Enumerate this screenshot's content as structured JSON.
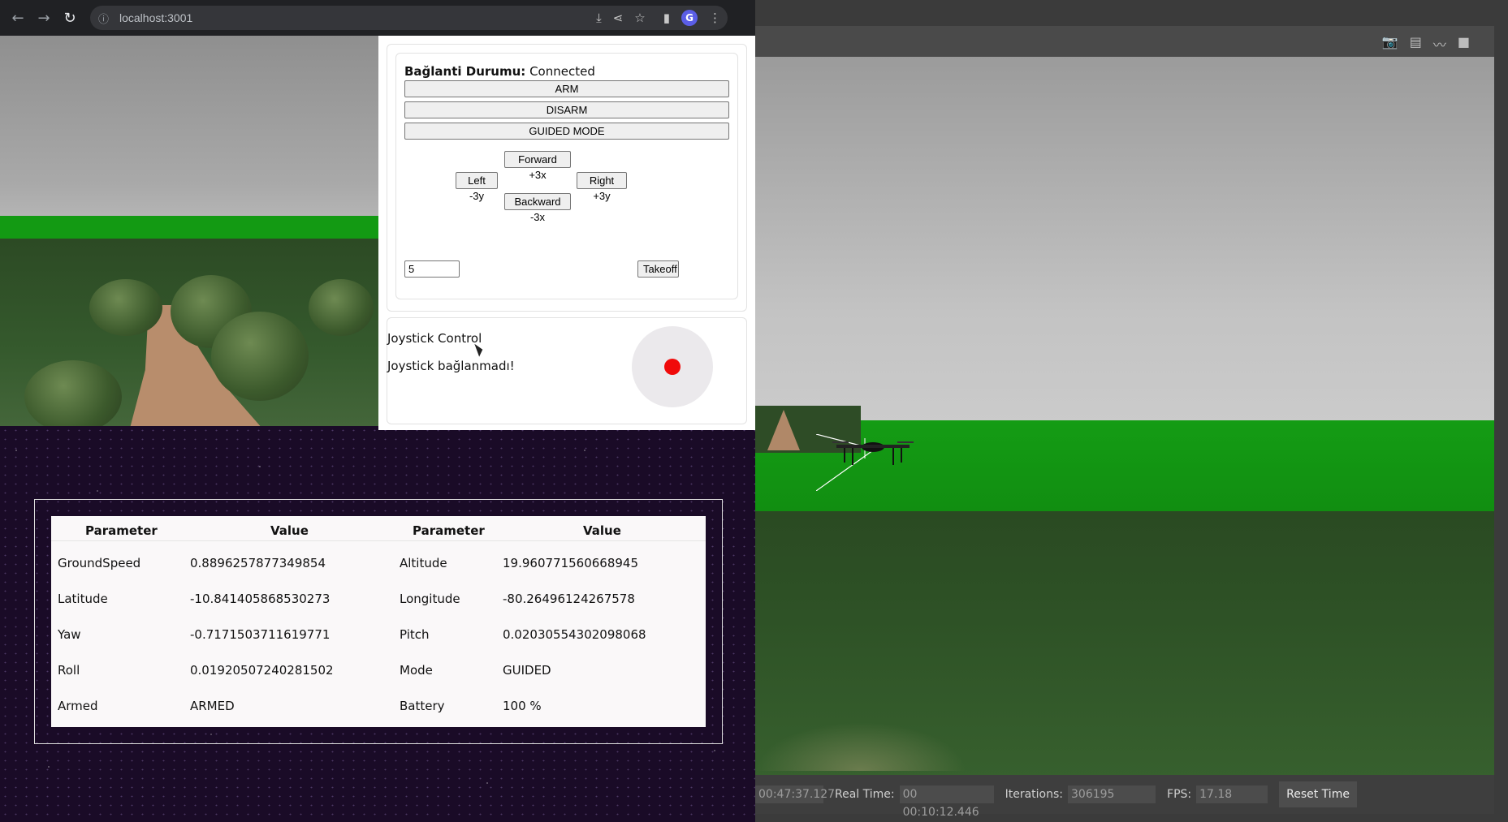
{
  "browser": {
    "url": "localhost:3001",
    "icons": [
      "back-icon",
      "forward-icon",
      "reload-icon",
      "info-icon",
      "install-icon",
      "share-icon",
      "star-icon",
      "sidepanel-icon",
      "extension-icon",
      "menu-icon"
    ],
    "extension_letter": "G"
  },
  "control": {
    "status_label": "Bağlanti Durumu:",
    "status_value": "Connected",
    "arm_label": "ARM",
    "disarm_label": "DISARM",
    "guided_label": "GUIDED MODE",
    "forward_label": "Forward +3x",
    "left_label": "Left -3y",
    "right_label": "Right +3y",
    "backward_label": "Backward -3x",
    "altitude_value": "5",
    "takeoff_label": "Takeoff"
  },
  "joystick": {
    "title": "Joystick Control",
    "status": "Joystick bağlanmadı!",
    "knob_color": "#f00a0a"
  },
  "telemetry": {
    "headers": [
      "Parameter",
      "Value",
      "Parameter",
      "Value"
    ],
    "rows": [
      [
        "GroundSpeed",
        "0.8896257877349854",
        "Altitude",
        "19.960771560668945"
      ],
      [
        "Latitude",
        "-10.841405868530273",
        "Longitude",
        "-80.26496124267578"
      ],
      [
        "Yaw",
        "-0.7171503711619771",
        "Pitch",
        "0.02030554302098068"
      ],
      [
        "Roll",
        "0.01920507240281502",
        "Mode",
        "GUIDED"
      ],
      [
        "Armed",
        "ARMED",
        "Battery",
        "100 %"
      ]
    ]
  },
  "gazebo": {
    "toolbar_icons": [
      "camera-icon",
      "log-icon",
      "plot-icon",
      "video-icon"
    ],
    "sim_time": "00:47:37.127",
    "real_time_label": "Real Time:",
    "real_time": "00 00:10:12.446",
    "iterations_label": "Iterations:",
    "iterations": "306195",
    "fps_label": "FPS:",
    "fps": "17.18",
    "reset_label": "Reset Time"
  }
}
